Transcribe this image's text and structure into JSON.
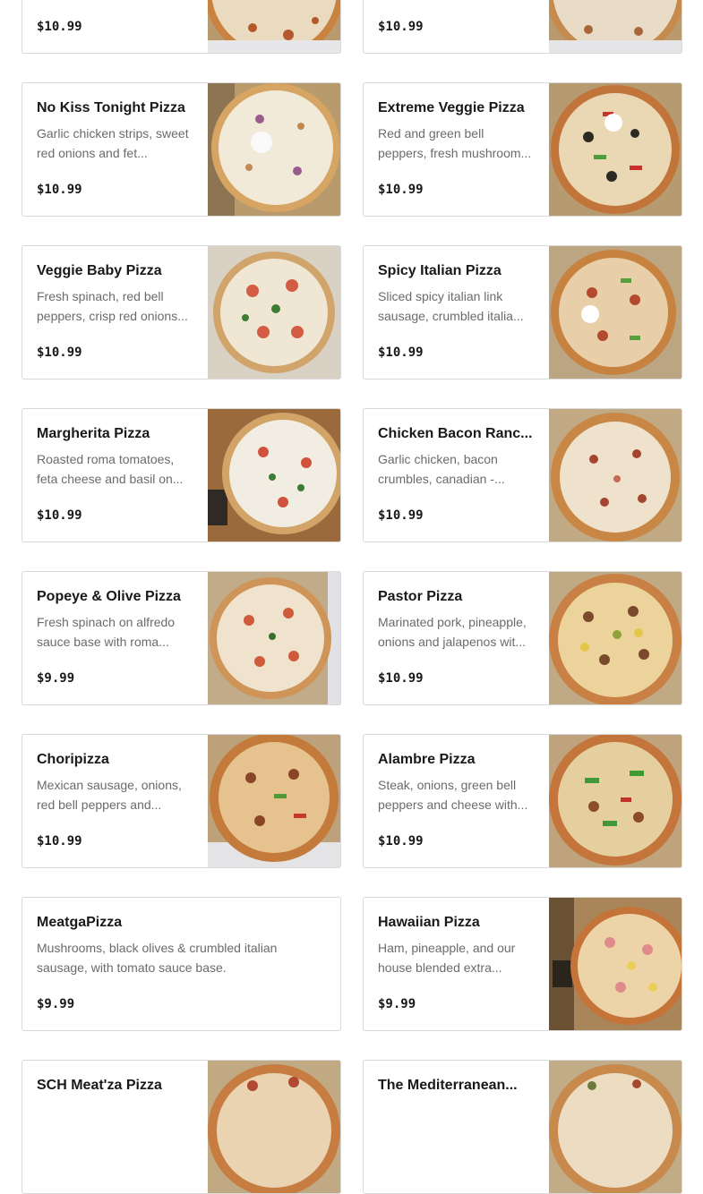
{
  "menu_items": [
    {
      "name": "",
      "description": "",
      "price": "$10.99",
      "has_image": true
    },
    {
      "name": "",
      "description": "",
      "price": "$10.99",
      "has_image": true
    },
    {
      "name": "No Kiss Tonight Pizza",
      "description": "Garlic chicken strips, sweet red onions and fet...",
      "price": "$10.99",
      "has_image": true
    },
    {
      "name": "Extreme Veggie Pizza",
      "description": "Red and green bell peppers, fresh mushroom...",
      "price": "$10.99",
      "has_image": true
    },
    {
      "name": "Veggie Baby Pizza",
      "description": "Fresh spinach, red bell peppers, crisp red onions...",
      "price": "$10.99",
      "has_image": true
    },
    {
      "name": "Spicy Italian Pizza",
      "description": "Sliced spicy italian link sausage, crumbled italia...",
      "price": "$10.99",
      "has_image": true
    },
    {
      "name": "Margherita Pizza",
      "description": "Roasted roma tomatoes, feta cheese and basil on...",
      "price": "$10.99",
      "has_image": true
    },
    {
      "name": "Chicken Bacon Ranc...",
      "description": "Garlic chicken, bacon crumbles, canadian -...",
      "price": "$10.99",
      "has_image": true
    },
    {
      "name": "Popeye & Olive Pizza",
      "description": "Fresh spinach on alfredo sauce base with roma...",
      "price": "$9.99",
      "has_image": true
    },
    {
      "name": "Pastor Pizza",
      "description": "Marinated pork, pineapple, onions and jalapenos wit...",
      "price": "$10.99",
      "has_image": true
    },
    {
      "name": "Choripizza",
      "description": "Mexican sausage, onions, red bell peppers and...",
      "price": "$10.99",
      "has_image": true
    },
    {
      "name": "Alambre Pizza",
      "description": "Steak, onions, green bell peppers and cheese with...",
      "price": "$10.99",
      "has_image": true
    },
    {
      "name": "MeatgaPizza",
      "description": "Mushrooms, black olives & crumbled italian sausage, with tomato sauce base.",
      "price": "$9.99",
      "has_image": false
    },
    {
      "name": "Hawaiian Pizza",
      "description": "Ham, pineapple, and our house blended extra...",
      "price": "$9.99",
      "has_image": true
    },
    {
      "name": "SCH Meat'za Pizza",
      "description": "",
      "price": "",
      "has_image": true
    },
    {
      "name": "The Mediterranean...",
      "description": "",
      "price": "",
      "has_image": true
    }
  ],
  "colors": {
    "card_border": "#d9d9d9",
    "title_text": "#191919",
    "description_text": "#6b6b6b",
    "price_text": "#191919"
  }
}
